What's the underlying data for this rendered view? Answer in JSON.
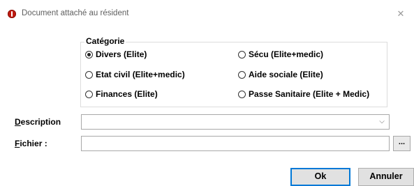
{
  "window": {
    "title": "Document attaché au résident",
    "close_glyph": "✕"
  },
  "category": {
    "label": "Catégorie",
    "options": [
      {
        "label": "Divers (Elite)",
        "checked": true
      },
      {
        "label": "Sécu (Elite+medic)",
        "checked": false
      },
      {
        "label": "Etat civil (Elite+medic)",
        "checked": false
      },
      {
        "label": "Aide sociale (Elite)",
        "checked": false
      },
      {
        "label": "Finances (Elite)",
        "checked": false
      },
      {
        "label": "Passe Sanitaire (Elite + Medic)",
        "checked": false
      }
    ]
  },
  "description": {
    "label_first": "D",
    "label_rest": "escription",
    "value": "",
    "arrow_glyph": "⌵"
  },
  "file": {
    "label_first": "F",
    "label_rest": "ichier :",
    "value": "",
    "browse_label": "..."
  },
  "buttons": {
    "ok": "Ok",
    "cancel": "Annuler"
  },
  "colors": {
    "app_icon": "#c21a10",
    "default_button_border": "#0078d7"
  }
}
